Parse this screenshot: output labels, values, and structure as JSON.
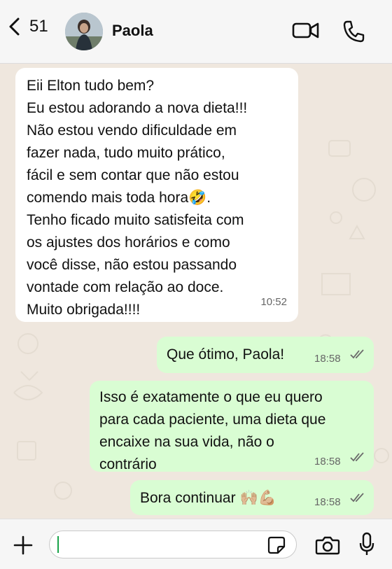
{
  "header": {
    "back_count": "51",
    "contact_name": "Paola",
    "icons": [
      "chevron-left-icon",
      "video-call-icon",
      "phone-icon"
    ]
  },
  "messages": [
    {
      "direction": "incoming",
      "text": "Eii Elton tudo bem?\nEu estou adorando a nova dieta!!!\nNão estou vendo dificuldade em\nfazer nada, tudo muito prático,\nfácil e sem contar que não estou\ncomendo mais toda hora🤣.\nTenho ficado muito satisfeita com\nos ajustes dos horários e como\nvocê disse, não estou passando\nvontade com relação ao doce.\nMuito obrigada!!!!",
      "time": "10:52"
    },
    {
      "direction": "outgoing",
      "text": "Que ótimo, Paola!",
      "time": "18:58",
      "status": "read"
    },
    {
      "direction": "outgoing",
      "text": "Isso é exatamente o que eu quero\npara cada paciente, uma dieta que\nencaixe na sua vida, não o\ncontrário",
      "time": "18:58",
      "status": "read"
    },
    {
      "direction": "outgoing",
      "text": "Bora continuar",
      "emoji": "🙌🏼💪🏼",
      "time": "18:58",
      "status": "read"
    }
  ],
  "footer": {
    "input_value": "",
    "icons": [
      "plus-icon",
      "sticker-icon",
      "camera-icon",
      "microphone-icon"
    ]
  },
  "colors": {
    "incoming_bubble": "#ffffff",
    "outgoing_bubble": "#d9fdd3",
    "background": "#efe7de",
    "read_ticks": "#6b6b6b"
  }
}
